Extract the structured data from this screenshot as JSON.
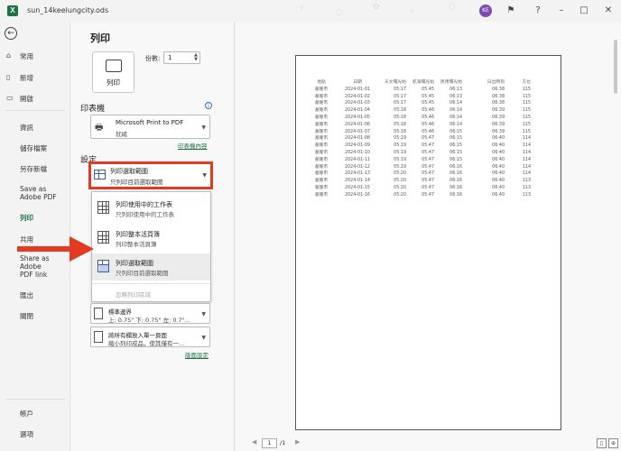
{
  "window": {
    "title": "sun_14keelungcity.ods",
    "app_icon": "excel-icon",
    "avatar_initials": "KE"
  },
  "nav": {
    "back_icon": "back-arrow-icon",
    "items": [
      {
        "label": "常用",
        "icon": "home-icon"
      },
      {
        "label": "新增",
        "icon": "new-file-icon"
      },
      {
        "label": "開啟",
        "icon": "folder-icon"
      },
      {
        "label": "資訊"
      },
      {
        "label": "儲存檔案"
      },
      {
        "label": "另存新檔"
      },
      {
        "label": "Save as Adobe PDF"
      },
      {
        "label": "列印"
      },
      {
        "label": "共用"
      },
      {
        "label": "Share as Adobe PDF link"
      },
      {
        "label": "匯出"
      },
      {
        "label": "關閉"
      },
      {
        "label": "帳戶"
      },
      {
        "label": "選項"
      }
    ]
  },
  "print_panel": {
    "heading": "列印",
    "print_button": "列印",
    "copies_label": "份數:",
    "copies_value": "1",
    "printer_section": "印表機",
    "printer_name": "Microsoft Print to PDF",
    "printer_status": "就緒",
    "printer_props_link": "印表機內容",
    "settings_section": "設定",
    "selected_option": {
      "title": "列印選取範圍",
      "desc": "只列印目前選取範圍"
    },
    "dropdown": [
      {
        "title": "列印使用中的工作表",
        "desc": "只列印使用中的工作表"
      },
      {
        "title": "列印整本活頁簿",
        "desc": "列印整本活頁簿"
      },
      {
        "title": "列印選取範圍",
        "desc": "只列印目前選取範圍"
      }
    ],
    "ignore_print_area": "忽略列印區域",
    "margins": {
      "title": "標準邊界",
      "desc": "上: 0.75\" 下: 0.75\" 左: 0.7\"..."
    },
    "scaling": {
      "title": "將所有欄放入單一頁面",
      "desc": "縮小列印成品，使其僅有一..."
    },
    "page_setup_link": "版面設定"
  },
  "preview": {
    "page_current": "1",
    "page_total": "/1",
    "headers": [
      "地點",
      "日期",
      "天文曙光始",
      "航海曙光始",
      "民用曙光始",
      "日出時刻",
      "方位"
    ],
    "rows": [
      [
        "基隆市",
        "2024-01-01",
        "05:17",
        "05:45",
        "06:13",
        "06:38",
        "115"
      ],
      [
        "基隆市",
        "2024-01-02",
        "05:17",
        "05:45",
        "06:13",
        "06:38",
        "115"
      ],
      [
        "基隆市",
        "2024-01-03",
        "05:17",
        "05:45",
        "06:14",
        "06:38",
        "115"
      ],
      [
        "基隆市",
        "2024-01-04",
        "05:18",
        "05:46",
        "06:14",
        "06:39",
        "115"
      ],
      [
        "基隆市",
        "2024-01-05",
        "05:18",
        "05:46",
        "06:14",
        "06:39",
        "115"
      ],
      [
        "基隆市",
        "2024-01-06",
        "05:18",
        "05:46",
        "06:14",
        "06:39",
        "115"
      ],
      [
        "基隆市",
        "2024-01-07",
        "05:18",
        "05:46",
        "06:15",
        "06:39",
        "115"
      ],
      [
        "基隆市",
        "2024-01-08",
        "05:19",
        "05:47",
        "06:15",
        "06:40",
        "114"
      ],
      [
        "基隆市",
        "2024-01-09",
        "05:19",
        "05:47",
        "06:15",
        "06:40",
        "114"
      ],
      [
        "基隆市",
        "2024-01-10",
        "05:19",
        "05:47",
        "06:15",
        "06:40",
        "114"
      ],
      [
        "基隆市",
        "2024-01-11",
        "05:19",
        "05:47",
        "06:15",
        "06:40",
        "114"
      ],
      [
        "基隆市",
        "2024-01-12",
        "05:19",
        "05:47",
        "06:16",
        "06:40",
        "114"
      ],
      [
        "基隆市",
        "2024-01-13",
        "05:20",
        "05:47",
        "06:16",
        "06:40",
        "114"
      ],
      [
        "基隆市",
        "2024-01-14",
        "05:20",
        "05:47",
        "06:16",
        "06:40",
        "113"
      ],
      [
        "基隆市",
        "2024-01-15",
        "05:20",
        "05:47",
        "06:16",
        "06:40",
        "113"
      ],
      [
        "基隆市",
        "2024-01-16",
        "05:20",
        "05:47",
        "06:16",
        "06:40",
        "113"
      ]
    ]
  },
  "colors": {
    "accent": "#1f7244",
    "highlight_red": "#e23b22"
  }
}
